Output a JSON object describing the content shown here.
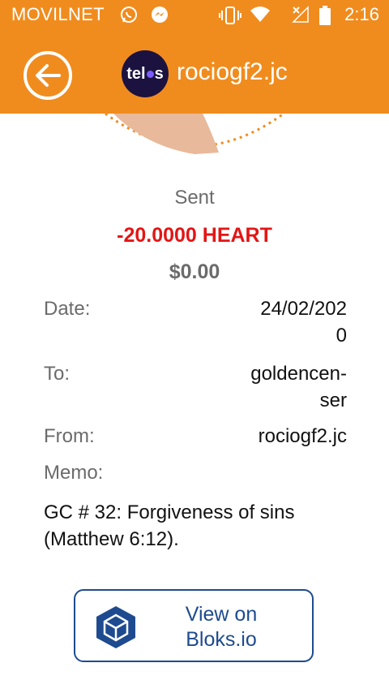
{
  "status_bar": {
    "carrier": "MOVILNET",
    "time": "2:16",
    "icons": [
      "whatsapp-icon",
      "messenger-icon",
      "vibrate-icon",
      "wifi-icon",
      "signal-icon",
      "battery-icon"
    ]
  },
  "app_bar": {
    "logo_text_left": "tel",
    "logo_text_right": "s",
    "title": "rociogf2.jc",
    "back_icon": "back-arrow-icon"
  },
  "transaction": {
    "direction": "Sent",
    "amount": "-20.0000 HEART",
    "fiat_value": "$0.00",
    "date_label": "Date:",
    "date_value_line1": "24/02/202",
    "date_value_line2": "0",
    "to_label": "To:",
    "to_value_line1": "goldencen-",
    "to_value_line2": "ser",
    "from_label": "From:",
    "from_value": "rociogf2.jc",
    "memo_label": "Memo:",
    "memo_line1": "GC # 32: Forgiveness of sins",
    "memo_line2": "(Matthew 6:12)."
  },
  "explorer_button": {
    "line1": "View on",
    "line2": "Bloks.io",
    "icon": "bloks-cube-icon"
  },
  "colors": {
    "accent": "#f08c1e",
    "negative": "#e31515",
    "link": "#1e4b8f"
  }
}
